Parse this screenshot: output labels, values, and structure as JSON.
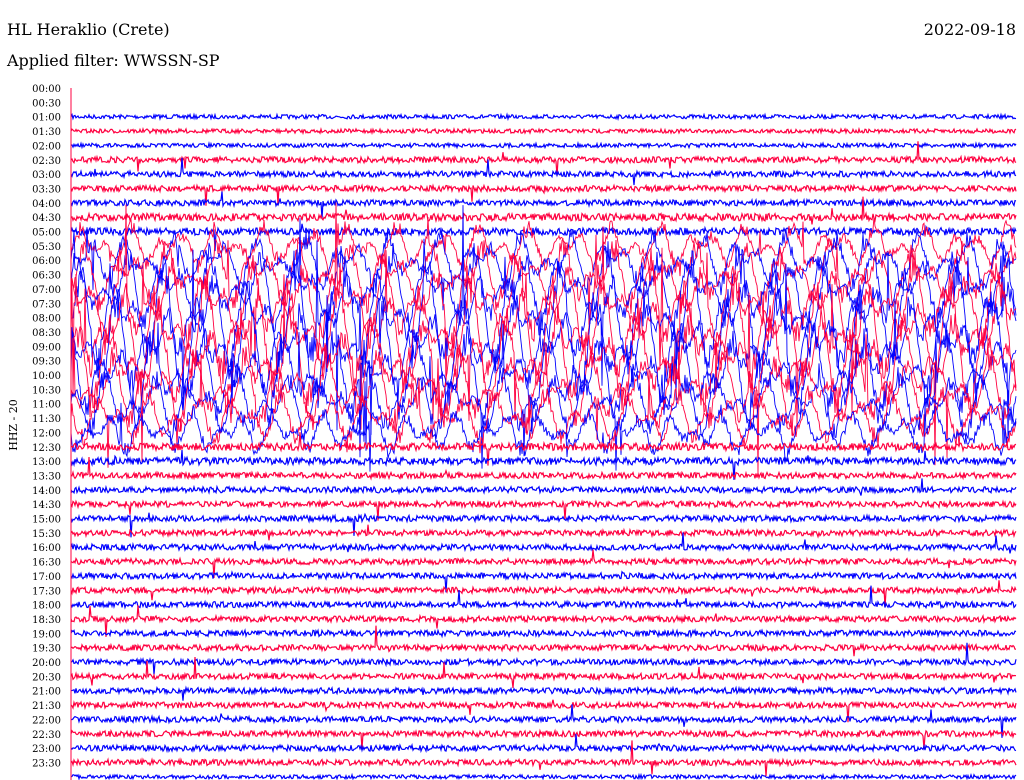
{
  "header": {
    "station": "HL Heraklio (Crete)",
    "date": "2022-09-18",
    "filter": "Applied filter: WWSSN-SP"
  },
  "chart_data": {
    "type": "line",
    "subtype": "helicorder",
    "ylabel": "HHZ - 20",
    "row_labels": [
      "00:00",
      "00:30",
      "01:00",
      "01:30",
      "02:00",
      "02:30",
      "03:00",
      "03:30",
      "04:00",
      "04:30",
      "05:00",
      "05:30",
      "06:00",
      "06:30",
      "07:00",
      "07:30",
      "08:00",
      "08:30",
      "09:00",
      "09:30",
      "10:00",
      "10:30",
      "11:00",
      "11:30",
      "12:00",
      "12:30",
      "13:00",
      "13:30",
      "14:00",
      "14:30",
      "15:00",
      "15:30",
      "16:00",
      "16:30",
      "17:00",
      "17:30",
      "18:00",
      "18:30",
      "19:00",
      "19:30",
      "20:00",
      "20:30",
      "21:00",
      "21:30",
      "22:00",
      "22:30",
      "23:00",
      "23:30"
    ],
    "trace_colors": [
      "#0000ff",
      "#ff0040"
    ],
    "row_amplitude": [
      0,
      0,
      1,
      1,
      1,
      2,
      2,
      2,
      2,
      3,
      3,
      4,
      5,
      6,
      7,
      8,
      10,
      10,
      10,
      9,
      8,
      7,
      6,
      5,
      4,
      3,
      3,
      2,
      2,
      2,
      2,
      2,
      2,
      2,
      2,
      2,
      2,
      2,
      2,
      2,
      2,
      2,
      2,
      2,
      2,
      2,
      2,
      2
    ],
    "row_amplitude_unit": "relative (0-10)",
    "events": [
      {
        "row": "03:00",
        "relative_position": 0.01,
        "note": "spike"
      },
      {
        "row": "06:00",
        "relative_position": 0.78,
        "note": "burst"
      },
      {
        "row": "04:00",
        "relative_position": 0.99,
        "note": "spike"
      },
      {
        "row": "12:00",
        "relative_position": 0.99,
        "note": "spike"
      }
    ]
  }
}
